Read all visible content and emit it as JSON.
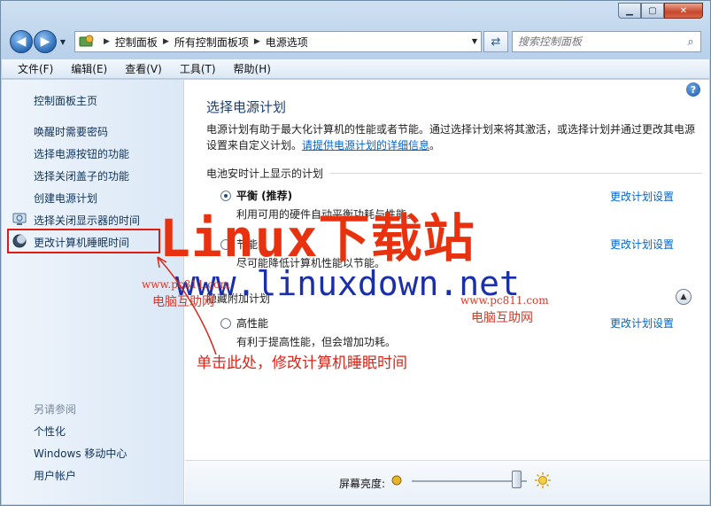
{
  "window": {
    "caption_buttons": [
      "minimize-icon",
      "maximize-icon",
      "close-icon"
    ]
  },
  "address": {
    "crumbs": [
      "控制面板",
      "所有控制面板项",
      "电源选项"
    ],
    "search_placeholder": "搜索控制面板"
  },
  "menu": [
    "文件(F)",
    "编辑(E)",
    "查看(V)",
    "工具(T)",
    "帮助(H)"
  ],
  "sidebar": {
    "home": "控制面板主页",
    "links": [
      "唤醒时需要密码",
      "选择电源按钮的功能",
      "选择关闭盖子的功能",
      "创建电源计划",
      "选择关闭显示器的时间",
      "更改计算机睡眠时间"
    ],
    "see_also_header": "另请参阅",
    "see_also": [
      "个性化",
      "Windows 移动中心",
      "用户帐户"
    ]
  },
  "content": {
    "title": "选择电源计划",
    "intro": "电源计划有助于最大化计算机的性能或者节能。通过选择计划来将其激活，或选择计划并通过更改其电源设置来自定义计划。",
    "intro_link": "请提供电源计划的详细信息",
    "intro_end": "。",
    "battery_group": "电池安时计上显示的计划",
    "plans": [
      {
        "name": "平衡 (推荐)",
        "desc": "利用可用的硬件自动平衡功耗与性能。",
        "selected": true,
        "change": "更改计划设置"
      },
      {
        "name": "节能",
        "desc": "尽可能降低计算机性能以节能。",
        "selected": false,
        "change": "更改计划设置"
      }
    ],
    "hidden_group": "隐藏附加计划",
    "hidden_plans": [
      {
        "name": "高性能",
        "desc": "有利于提高性能，但会增加功耗。",
        "selected": false,
        "change": "更改计划设置"
      }
    ],
    "brightness_label": "屏幕亮度:",
    "brightness_value": 0.95
  },
  "overlay": {
    "watermark_title": "Linux下载站",
    "watermark_url": "www.linuxdown.net",
    "site_left_url": "www.pc811.com",
    "site_left_name": "电脑互助网",
    "site_right_url": "www.pc811.com",
    "site_right_name": "电脑互助网",
    "annotation": "单击此处，修改计算机睡眠时间",
    "highlight_color": "#e21b12"
  }
}
